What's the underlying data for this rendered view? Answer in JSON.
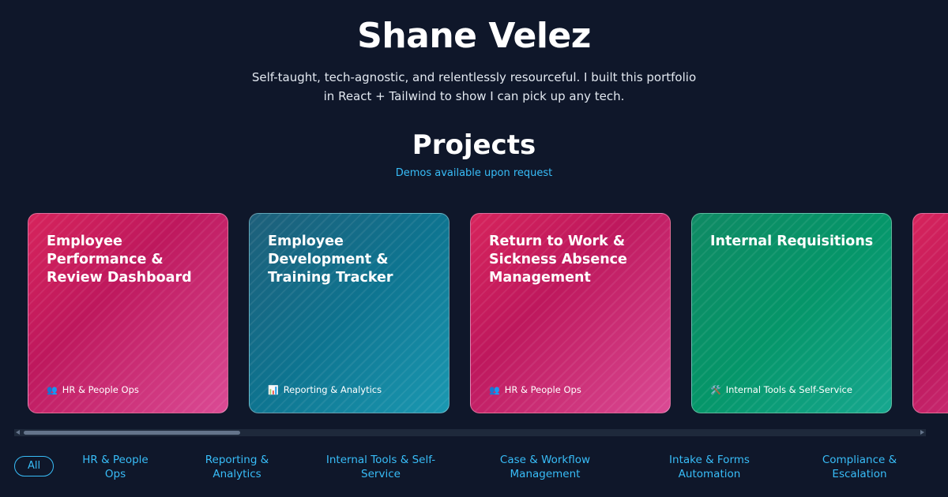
{
  "hero": {
    "name": "Shane Velez",
    "tagline": "Self-taught, tech-agnostic, and relentlessly resourceful. I built this portfolio in React + Tailwind to show I can pick up any tech."
  },
  "projects": {
    "heading": "Projects",
    "subheading": "Demos available upon request",
    "cards": [
      {
        "title": "Employee Performance & Review Dashboard",
        "tag_icon": "👥",
        "tag": "HR & People Ops",
        "color": "pink"
      },
      {
        "title": "Employee Development & Training Tracker",
        "tag_icon": "📊",
        "tag": "Reporting & Analytics",
        "color": "teal"
      },
      {
        "title": "Return to Work & Sickness Absence Management",
        "tag_icon": "👥",
        "tag": "HR & People Ops",
        "color": "pink"
      },
      {
        "title": "Internal Requisitions",
        "tag_icon": "🛠️",
        "tag": "Internal Tools & Self-Service",
        "color": "green"
      },
      {
        "title": "",
        "tag_icon": "",
        "tag": "",
        "color": "pink"
      }
    ]
  },
  "filters": {
    "all": "All",
    "items": [
      "HR & People Ops",
      "Reporting & Analytics",
      "Internal Tools & Self-Service",
      "Case & Workflow Management",
      "Intake & Forms Automation",
      "Compliance & Escalation"
    ]
  }
}
